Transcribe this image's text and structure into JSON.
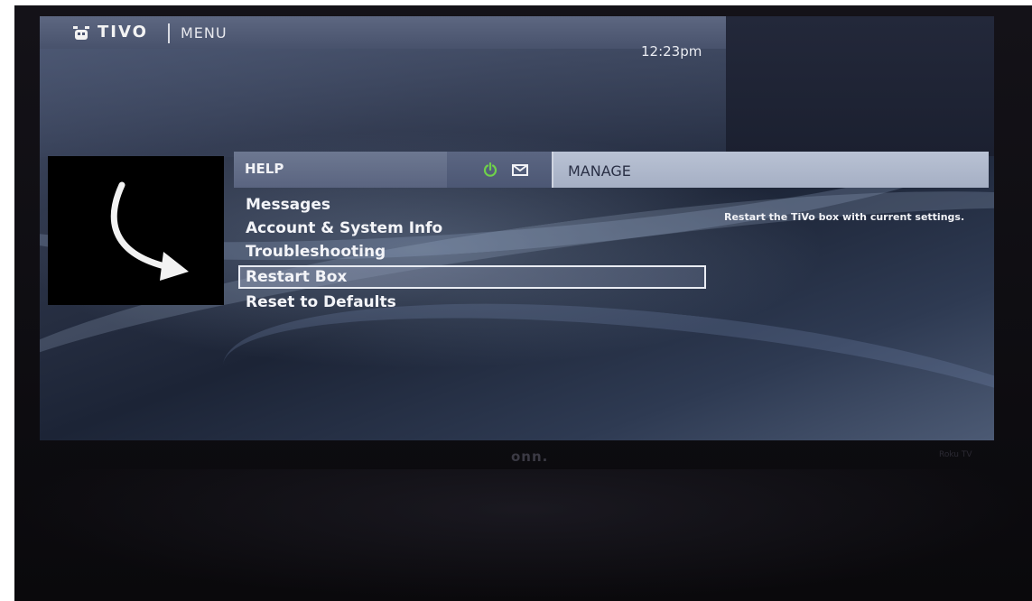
{
  "header": {
    "logo_text": "TIVO",
    "menu_label": "MENU",
    "clock": "12:23pm"
  },
  "tabs": {
    "help_label": "HELP",
    "manage_label": "MANAGE",
    "icons": [
      "power-icon",
      "mail-icon"
    ]
  },
  "menu": {
    "items": [
      {
        "label": "Messages"
      },
      {
        "label": "Account & System Info"
      },
      {
        "label": "Troubleshooting"
      },
      {
        "label": "Restart Box",
        "selected": true
      },
      {
        "label": "Reset to Defaults"
      }
    ]
  },
  "description": "Restart the TiVo box with current settings.",
  "tv": {
    "brand": "onn.",
    "brand_right": "Roku TV"
  },
  "colors": {
    "power_icon": "#6fd14a",
    "selection_border": "#e9ecf3"
  }
}
